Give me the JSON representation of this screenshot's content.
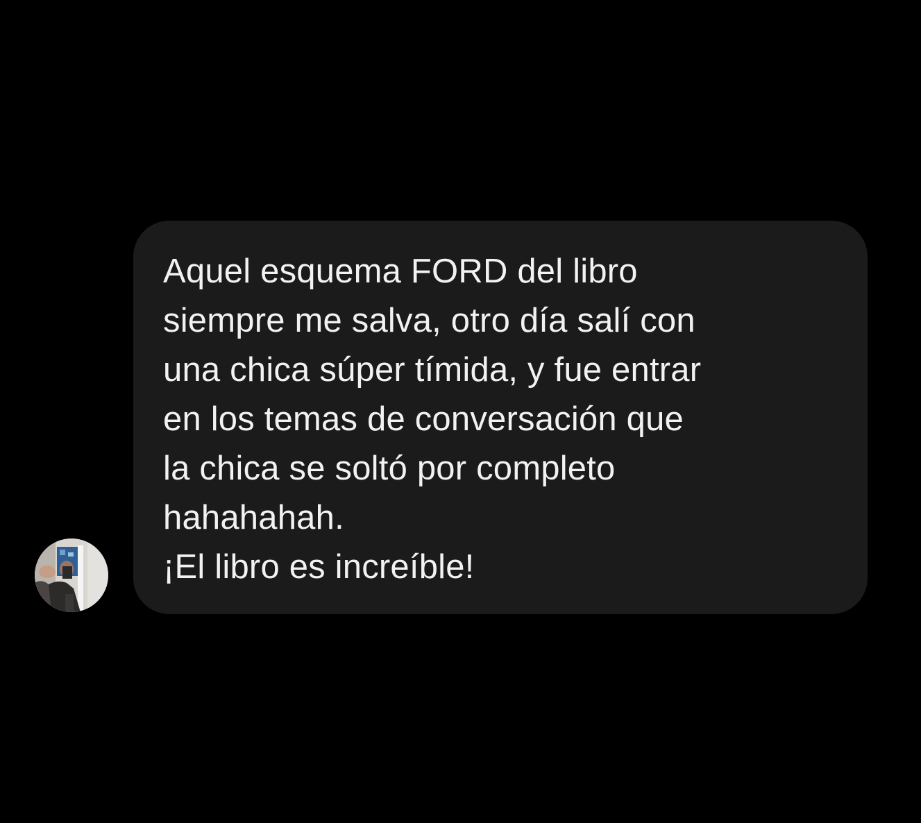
{
  "conversation": {
    "message": {
      "lines": [
        "Aquel esquema FORD del libro",
        "siempre me salva, otro día salí con",
        "una chica súper tímida, y fue entrar",
        "en los temas de conversación que",
        "la chica se soltó por completo",
        "hahahahah.",
        "¡El libro es increíble!"
      ]
    },
    "sender_avatar": {
      "icon": "profile-photo-avatar"
    }
  },
  "colors": {
    "background": "#000000",
    "bubble": "#1b1b1b",
    "text": "#f2f2f2"
  }
}
